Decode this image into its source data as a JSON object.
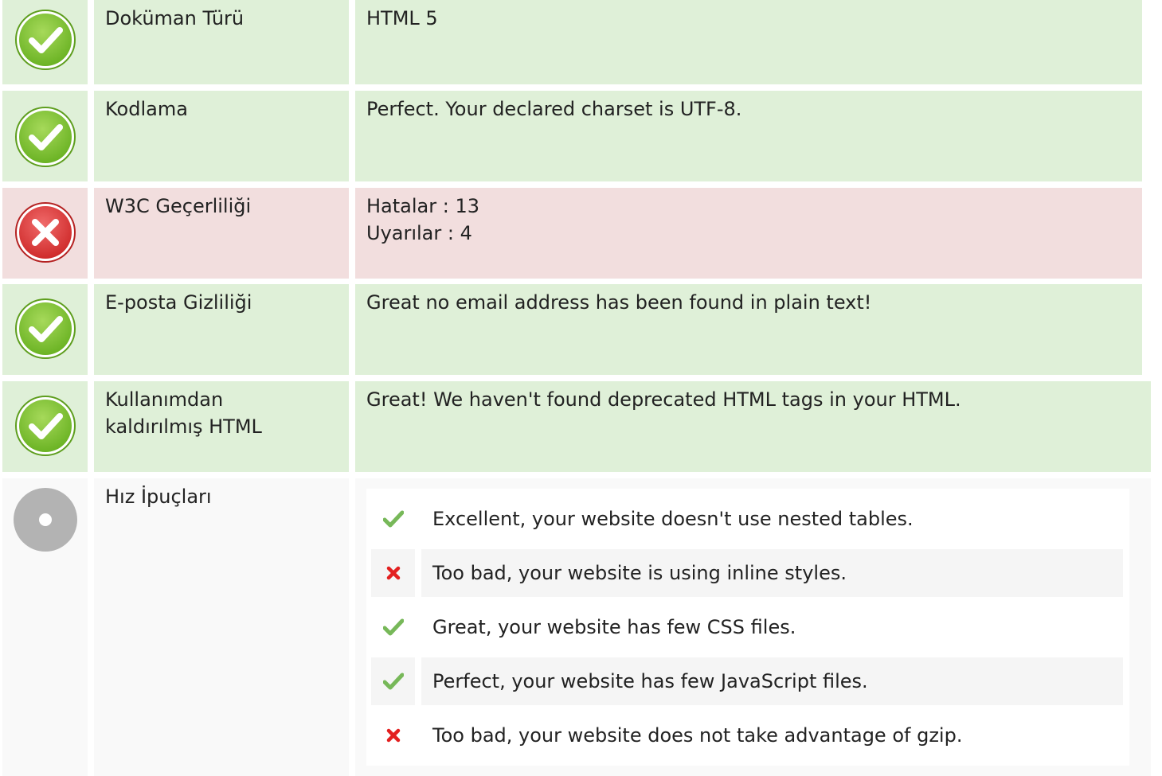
{
  "rows": [
    {
      "status": "ok",
      "icon": "check-circle-icon",
      "label": "Doküman Türü",
      "values": [
        "HTML 5"
      ]
    },
    {
      "status": "ok",
      "icon": "check-circle-icon",
      "label": "Kodlama",
      "values": [
        "Perfect. Your declared charset is UTF-8."
      ]
    },
    {
      "status": "error",
      "icon": "error-circle-icon",
      "label": "W3C Geçerliliği",
      "values": [
        "Hatalar : 13",
        "Uyarılar : 4"
      ]
    },
    {
      "status": "ok",
      "icon": "check-circle-icon",
      "label": "E-posta Gizliliği",
      "values": [
        "Great no email address has been found in plain text!"
      ]
    },
    {
      "status": "ok",
      "icon": "check-circle-icon",
      "label_lines": [
        "Kullanımdan",
        "kaldırılmış HTML"
      ],
      "values": [
        "Great! We haven't found deprecated HTML tags in your HTML."
      ]
    },
    {
      "status": "info",
      "icon": "neutral-circle-icon",
      "label": "Hız İpuçları"
    }
  ],
  "speed_tips": [
    {
      "status": "pass",
      "icon": "check-mark-icon",
      "text": "Excellent, your website doesn't use nested tables."
    },
    {
      "status": "fail",
      "icon": "cross-mark-icon",
      "text": "Too bad, your website is using inline styles."
    },
    {
      "status": "pass",
      "icon": "check-mark-icon",
      "text": "Great, your website has few CSS files."
    },
    {
      "status": "pass",
      "icon": "check-mark-icon",
      "text": "Perfect, your website has few JavaScript files."
    },
    {
      "status": "fail",
      "icon": "cross-mark-icon",
      "text": "Too bad, your website does not take advantage of gzip."
    }
  ],
  "colors": {
    "ok_bg": "#dff0d8",
    "error_bg": "#f2dede",
    "info_bg": "#f9f9f9",
    "check_green": "#7cc242",
    "error_red": "#d9383a",
    "neutral_gray": "#b3b3b3",
    "tick_green": "#77b859",
    "cross_red": "#e32020"
  }
}
